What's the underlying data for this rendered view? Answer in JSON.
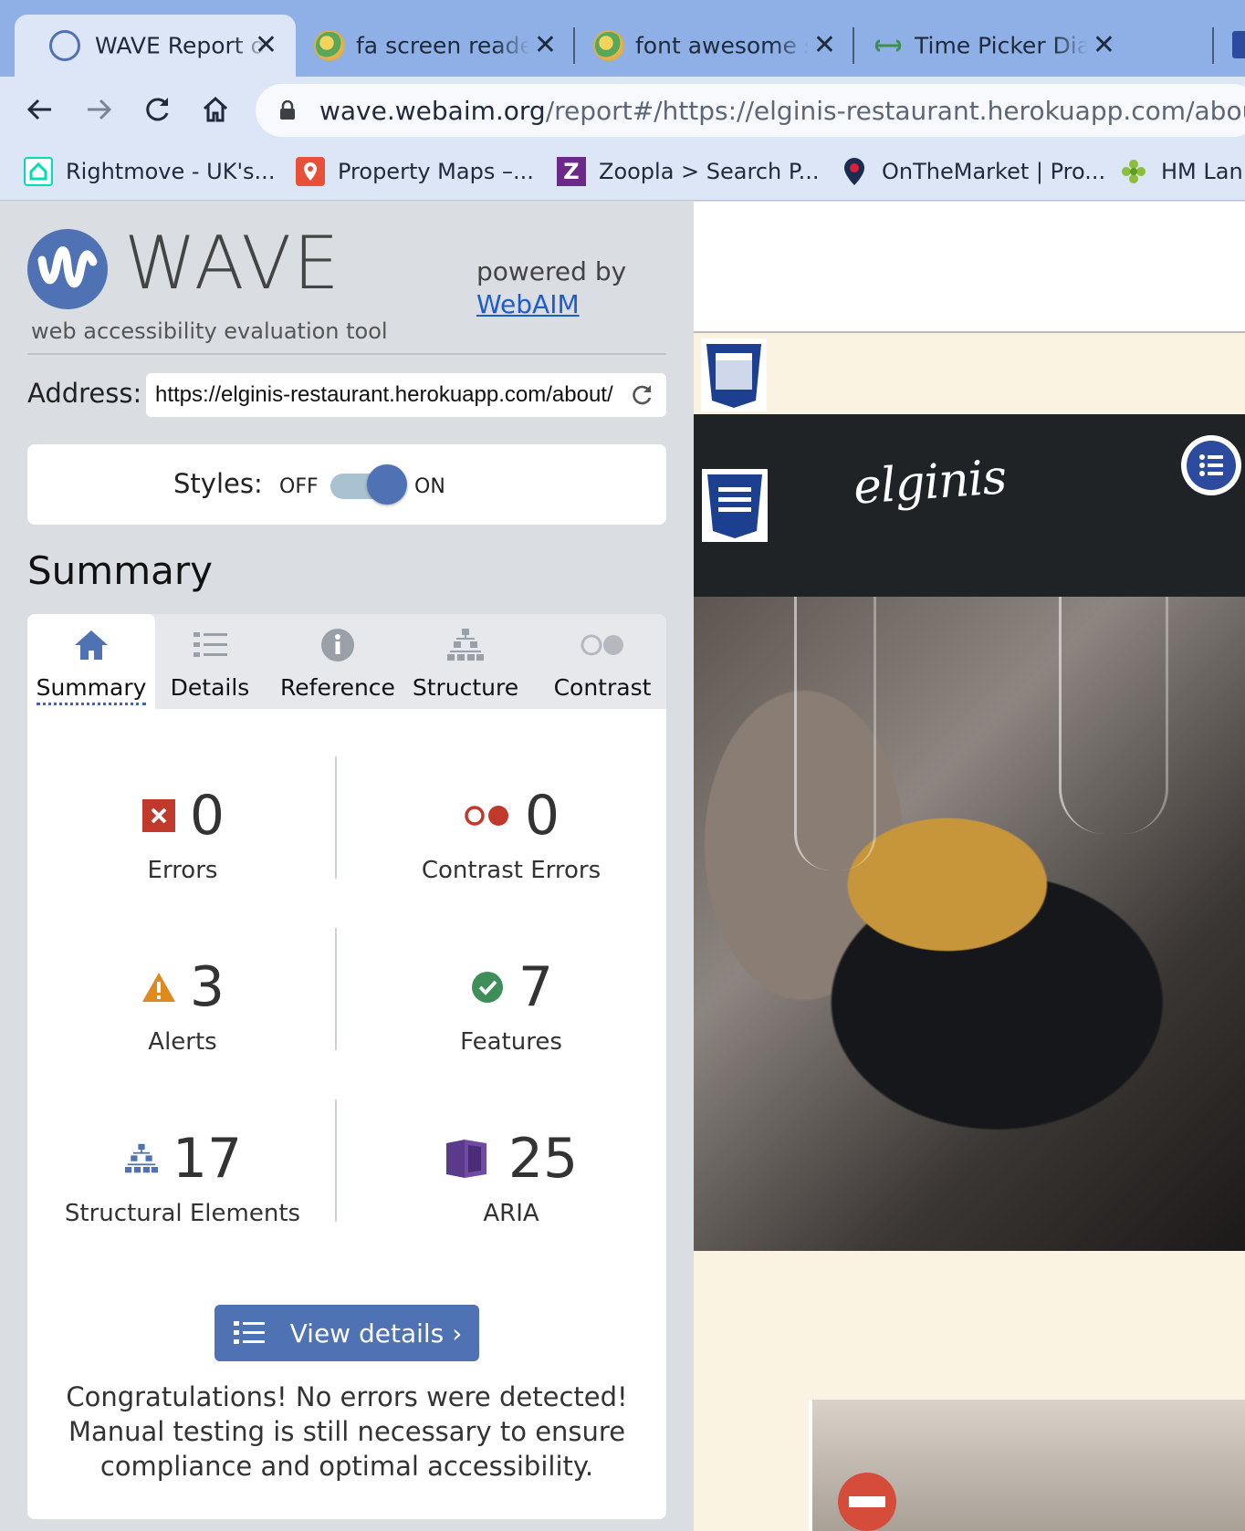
{
  "browser": {
    "tabs": [
      {
        "title": "WAVE Report of E",
        "active": true,
        "icon": "wave-favicon"
      },
      {
        "title": "fa screen reader c",
        "active": false,
        "icon": "globe-favicon"
      },
      {
        "title": "font awesome scr",
        "active": false,
        "icon": "globe-favicon"
      },
      {
        "title": "Time Picker Dialo",
        "active": false,
        "icon": "link-favicon"
      }
    ],
    "url_domain": "wave.webaim.org",
    "url_path": "/report#/https://elginis-restaurant.herokuapp.com/about/",
    "bookmarks": [
      {
        "label": "Rightmove - UK's...",
        "icon": "rightmove-icon",
        "color": "#00deb6"
      },
      {
        "label": "Property Maps –...",
        "icon": "map-pin-icon",
        "color": "#e8503a"
      },
      {
        "label": "Zoopla > Search P...",
        "icon": "zoopla-icon",
        "color": "#6b2a8a"
      },
      {
        "label": "OnTheMarket | Pro...",
        "icon": "location-pin-icon",
        "color": "#d81f3c"
      },
      {
        "label": "HM Lan",
        "icon": "hmland-icon",
        "color": "#8bbf3a"
      }
    ]
  },
  "wave": {
    "logo_word": "WAVE",
    "tagline": "web accessibility evaluation tool",
    "powered_by": "powered by",
    "powered_link": "WebAIM",
    "address_label": "Address:",
    "address_value": "https://elginis-restaurant.herokuapp.com/about/",
    "styles_label": "Styles:",
    "toggle_off": "OFF",
    "toggle_on": "ON",
    "styles_on": true,
    "summary_heading": "Summary",
    "tabs": [
      {
        "label": "Summary",
        "icon": "home-icon",
        "active": true
      },
      {
        "label": "Details",
        "icon": "list-icon",
        "active": false
      },
      {
        "label": "Reference",
        "icon": "info-icon",
        "active": false
      },
      {
        "label": "Structure",
        "icon": "hierarchy-icon",
        "active": false
      },
      {
        "label": "Contrast",
        "icon": "contrast-icon",
        "active": false
      }
    ],
    "stats": {
      "errors": {
        "value": "0",
        "label": "Errors",
        "color": "#c0392b"
      },
      "contrast_errors": {
        "value": "0",
        "label": "Contrast Errors",
        "color": "#c0392b"
      },
      "alerts": {
        "value": "3",
        "label": "Alerts",
        "color": "#e08a1e"
      },
      "features": {
        "value": "7",
        "label": "Features",
        "color": "#3e8e5a"
      },
      "structural": {
        "value": "17",
        "label": "Structural Elements",
        "color": "#4f72b5"
      },
      "aria": {
        "value": "25",
        "label": "ARIA",
        "color": "#5b3a8c"
      }
    },
    "view_details": "View details ›",
    "congrats": "Congratulations! No errors were detected! Manual testing is still necessary to ensure compliance and optimal accessibility."
  },
  "preview": {
    "brand": "elginis"
  },
  "colors": {
    "accent": "#4f72b5",
    "tabstrip": "#8eb0e6",
    "toolbar": "#dce6f6"
  }
}
